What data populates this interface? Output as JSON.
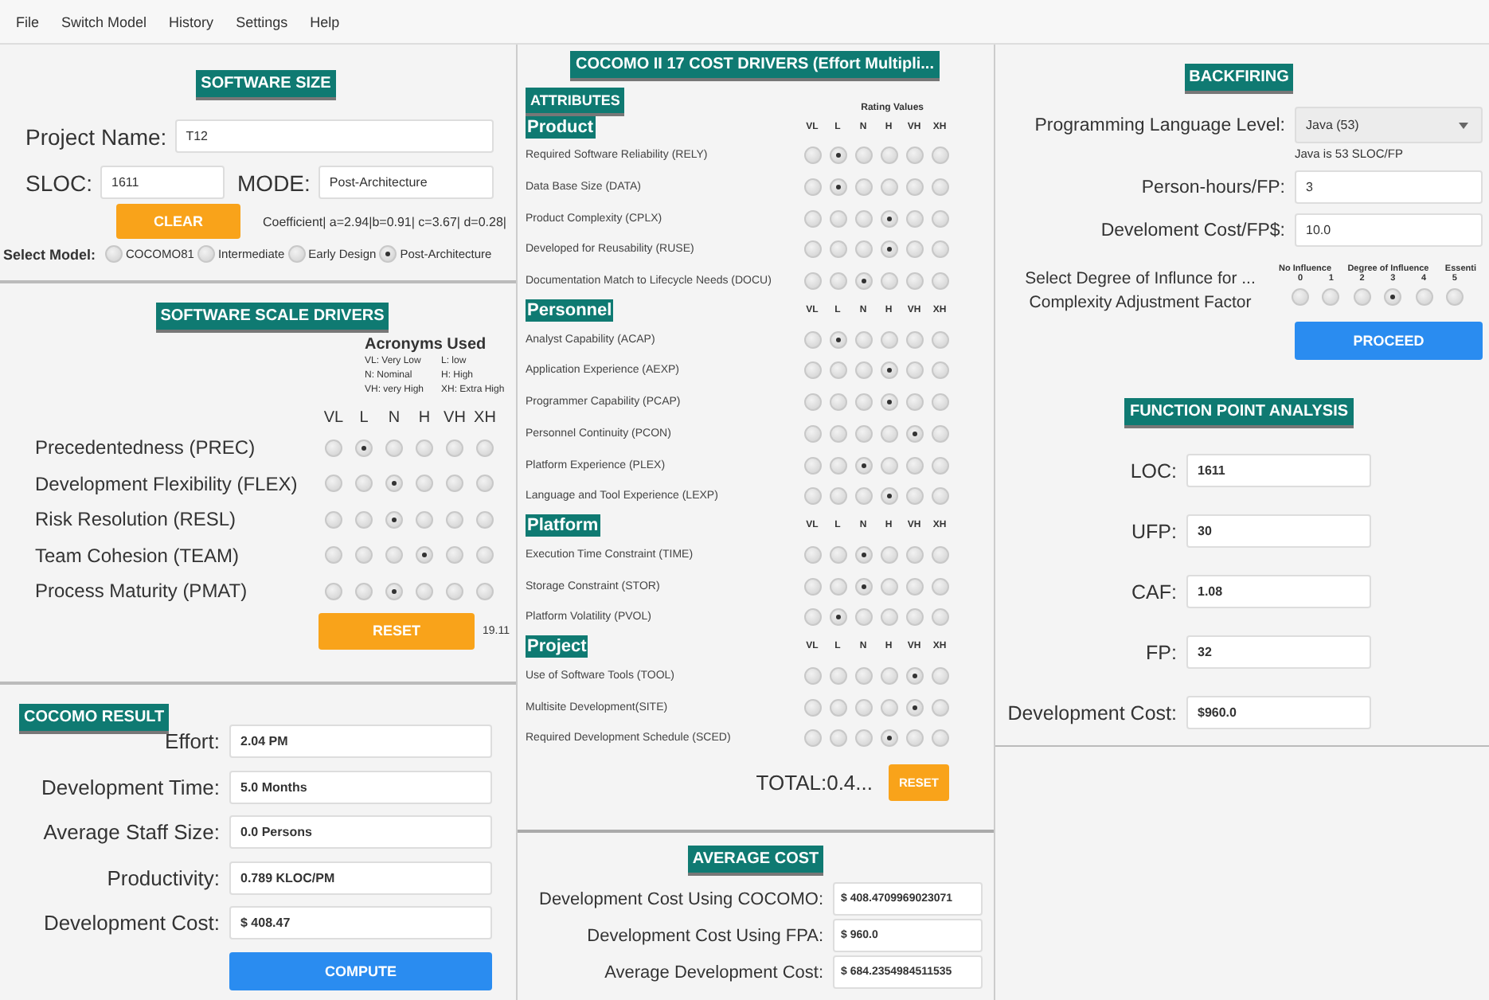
{
  "menu": [
    "File",
    "Switch Model",
    "History",
    "Settings",
    "Help"
  ],
  "software_size": {
    "title": "SOFTWARE SIZE",
    "project_name": {
      "label": "Project Name:",
      "value": "T12"
    },
    "sloc": {
      "label": "SLOC:",
      "value": "1611"
    },
    "mode": {
      "label": "MODE:",
      "value": "Post-Architecture"
    },
    "clear_button": "CLEAR",
    "coefficient": "Coefficient| a=2.94|b=0.91| c=3.67| d=0.28|",
    "select_model": {
      "label": "Select Model:",
      "options": [
        {
          "label": "COCOMO81",
          "selected": false
        },
        {
          "label": "Intermediate",
          "selected": false
        },
        {
          "label": "Early Design",
          "selected": false
        },
        {
          "label": "Post-Architecture",
          "selected": true
        }
      ]
    }
  },
  "scale_drivers": {
    "title": "SOFTWARE SCALE DRIVERS",
    "acronyms": {
      "title": "Acronyms Used",
      "items": [
        "VL: Very Low",
        "L: low",
        "N: Nominal",
        "H: High",
        "VH: very High",
        "XH: Extra High"
      ]
    },
    "columns": [
      "VL",
      "L",
      "N",
      "H",
      "VH",
      "XH"
    ],
    "rows": [
      {
        "name": "Precedentedness (PREC)",
        "ratings": [
          {
            "selected": false
          },
          {
            "selected": true
          },
          {
            "selected": false
          },
          {
            "selected": false
          },
          {
            "selected": false
          },
          {
            "selected": false
          }
        ]
      },
      {
        "name": "Development Flexibility (FLEX)",
        "ratings": [
          {
            "selected": false
          },
          {
            "selected": false
          },
          {
            "selected": true
          },
          {
            "selected": false
          },
          {
            "selected": false
          },
          {
            "selected": false
          }
        ]
      },
      {
        "name": "Risk Resolution (RESL)",
        "ratings": [
          {
            "selected": false
          },
          {
            "selected": false
          },
          {
            "selected": true
          },
          {
            "selected": false
          },
          {
            "selected": false
          },
          {
            "selected": false
          }
        ]
      },
      {
        "name": "Team Cohesion (TEAM)",
        "ratings": [
          {
            "selected": false
          },
          {
            "selected": false
          },
          {
            "selected": false
          },
          {
            "selected": true
          },
          {
            "selected": false
          },
          {
            "selected": false
          }
        ]
      },
      {
        "name": "Process Maturity (PMAT)",
        "ratings": [
          {
            "selected": false
          },
          {
            "selected": false
          },
          {
            "selected": true
          },
          {
            "selected": false
          },
          {
            "selected": false
          },
          {
            "selected": false
          }
        ]
      }
    ],
    "reset_button": "RESET",
    "total": "19.11"
  },
  "cocomo_result": {
    "title": "COCOMO RESULT",
    "fields": [
      {
        "label": "Effort:",
        "value": "2.04 PM"
      },
      {
        "label": "Development Time:",
        "value": "5.0 Months"
      },
      {
        "label": "Average Staff Size:",
        "value": "0.0 Persons"
      },
      {
        "label": "Productivity:",
        "value": "0.789 KLOC/PM"
      },
      {
        "label": "Development Cost:",
        "value": "$ 408.47"
      }
    ],
    "compute_button": "COMPUTE"
  },
  "cost_drivers": {
    "title": "COCOMO II 17 COST DRIVERS (Effort Multipli...",
    "attributes_label": "ATTRIBUTES",
    "rating_values_label": "Rating Values",
    "groups": [
      {
        "name": "Product",
        "columns": [
          "VL",
          "L",
          "N",
          "H",
          "VH",
          "XH"
        ],
        "rows": [
          {
            "name": "Required Software Reliability (RELY)",
            "ratings": [
              {
                "selected": false
              },
              {
                "selected": true
              },
              {
                "selected": false
              },
              {
                "selected": false
              },
              {
                "selected": false
              },
              {
                "selected": false
              }
            ]
          },
          {
            "name": "Data Base Size (DATA)",
            "ratings": [
              {
                "selected": false
              },
              {
                "selected": true
              },
              {
                "selected": false
              },
              {
                "selected": false
              },
              {
                "selected": false
              },
              {
                "selected": false
              }
            ]
          },
          {
            "name": "Product Complexity (CPLX)",
            "ratings": [
              {
                "selected": false
              },
              {
                "selected": false
              },
              {
                "selected": false
              },
              {
                "selected": true
              },
              {
                "selected": false
              },
              {
                "selected": false
              }
            ]
          },
          {
            "name": "Developed for Reusability (RUSE)",
            "ratings": [
              {
                "selected": false
              },
              {
                "selected": false
              },
              {
                "selected": false
              },
              {
                "selected": true
              },
              {
                "selected": false
              },
              {
                "selected": false
              }
            ]
          },
          {
            "name": "Documentation Match to Lifecycle Needs (DOCU)",
            "ratings": [
              {
                "selected": false
              },
              {
                "selected": false
              },
              {
                "selected": true
              },
              {
                "selected": false
              },
              {
                "selected": false
              },
              {
                "selected": false
              }
            ]
          }
        ]
      },
      {
        "name": "Personnel",
        "columns": [
          "VL",
          "L",
          "N",
          "H",
          "VH",
          "XH"
        ],
        "rows": [
          {
            "name": "Analyst Capability (ACAP)",
            "ratings": [
              {
                "selected": false
              },
              {
                "selected": true
              },
              {
                "selected": false
              },
              {
                "selected": false
              },
              {
                "selected": false
              },
              {
                "selected": false
              }
            ]
          },
          {
            "name": "Application Experience (AEXP)",
            "ratings": [
              {
                "selected": false
              },
              {
                "selected": false
              },
              {
                "selected": false
              },
              {
                "selected": true
              },
              {
                "selected": false
              },
              {
                "selected": false
              }
            ]
          },
          {
            "name": "Programmer Capability (PCAP)",
            "ratings": [
              {
                "selected": false
              },
              {
                "selected": false
              },
              {
                "selected": false
              },
              {
                "selected": true
              },
              {
                "selected": false
              },
              {
                "selected": false
              }
            ]
          },
          {
            "name": "Personnel Continuity (PCON)",
            "ratings": [
              {
                "selected": false
              },
              {
                "selected": false
              },
              {
                "selected": false
              },
              {
                "selected": false
              },
              {
                "selected": true
              },
              {
                "selected": false
              }
            ]
          },
          {
            "name": "Platform Experience (PLEX)",
            "ratings": [
              {
                "selected": false
              },
              {
                "selected": false
              },
              {
                "selected": true
              },
              {
                "selected": false
              },
              {
                "selected": false
              },
              {
                "selected": false
              }
            ]
          },
          {
            "name": "Language and Tool Experience (LEXP)",
            "ratings": [
              {
                "selected": false
              },
              {
                "selected": false
              },
              {
                "selected": false
              },
              {
                "selected": true
              },
              {
                "selected": false
              },
              {
                "selected": false
              }
            ]
          }
        ]
      },
      {
        "name": "Platform",
        "columns": [
          "VL",
          "L",
          "N",
          "H",
          "VH",
          "XH"
        ],
        "rows": [
          {
            "name": "Execution Time Constraint (TIME)",
            "ratings": [
              {
                "selected": false
              },
              {
                "selected": false
              },
              {
                "selected": true
              },
              {
                "selected": false
              },
              {
                "selected": false
              },
              {
                "selected": false
              }
            ]
          },
          {
            "name": "Storage Constraint (STOR)",
            "ratings": [
              {
                "selected": false
              },
              {
                "selected": false
              },
              {
                "selected": true
              },
              {
                "selected": false
              },
              {
                "selected": false
              },
              {
                "selected": false
              }
            ]
          },
          {
            "name": "Platform Volatility (PVOL)",
            "ratings": [
              {
                "selected": false
              },
              {
                "selected": true
              },
              {
                "selected": false
              },
              {
                "selected": false
              },
              {
                "selected": false
              },
              {
                "selected": false
              }
            ]
          }
        ]
      },
      {
        "name": "Project",
        "columns": [
          "VL",
          "L",
          "N",
          "H",
          "VH",
          "XH"
        ],
        "rows": [
          {
            "name": "Use of Software Tools (TOOL)",
            "ratings": [
              {
                "selected": false
              },
              {
                "selected": false
              },
              {
                "selected": false
              },
              {
                "selected": false
              },
              {
                "selected": true
              },
              {
                "selected": false
              }
            ]
          },
          {
            "name": "Multisite Development(SITE)",
            "ratings": [
              {
                "selected": false
              },
              {
                "selected": false
              },
              {
                "selected": false
              },
              {
                "selected": false
              },
              {
                "selected": true
              },
              {
                "selected": false
              }
            ]
          },
          {
            "name": "Required Development Schedule (SCED)",
            "ratings": [
              {
                "selected": false
              },
              {
                "selected": false
              },
              {
                "selected": false
              },
              {
                "selected": true
              },
              {
                "selected": false
              },
              {
                "selected": false
              }
            ]
          }
        ]
      }
    ],
    "total": "TOTAL:0.4...",
    "reset_button": "RESET"
  },
  "average_cost": {
    "title": "AVERAGE COST",
    "fields": [
      {
        "label": "Development Cost Using COCOMO:",
        "value": "$ 408.4709969023071"
      },
      {
        "label": "Development Cost Using FPA:",
        "value": "$ 960.0"
      },
      {
        "label": "Average Development Cost:",
        "value": "$ 684.2354984511535"
      }
    ]
  },
  "backfiring": {
    "title": "BACKFIRING",
    "language": {
      "label": "Programming Language Level:",
      "value": "Java (53)",
      "note": "Java is 53 SLOC/FP"
    },
    "person_hours": {
      "label": "Person-hours/FP:",
      "value": "3"
    },
    "cost_per_fp": {
      "label": "Develoment Cost/FP$:",
      "value": "10.0"
    },
    "influence": {
      "label_lines": [
        "Select Degree of Influnce for ...",
        "Complexity Adjustment Factor"
      ],
      "low_label": "No Influence",
      "mid_label": "Degree of Influence",
      "high_label": "Essenti",
      "options": [
        {
          "label": "0",
          "selected": false
        },
        {
          "label": "1",
          "selected": false
        },
        {
          "label": "2",
          "selected": false
        },
        {
          "label": "3",
          "selected": true
        },
        {
          "label": "4",
          "selected": false
        },
        {
          "label": "5",
          "selected": false
        }
      ]
    },
    "proceed_button": "PROCEED"
  },
  "function_point": {
    "title": "FUNCTION POINT  ANALYSIS",
    "fields": [
      {
        "label": "LOC:",
        "value": "1611"
      },
      {
        "label": "UFP:",
        "value": "30"
      },
      {
        "label": "CAF:",
        "value": "1.08"
      },
      {
        "label": "FP:",
        "value": "32"
      },
      {
        "label": "Development Cost:",
        "value": "$960.0"
      }
    ]
  }
}
